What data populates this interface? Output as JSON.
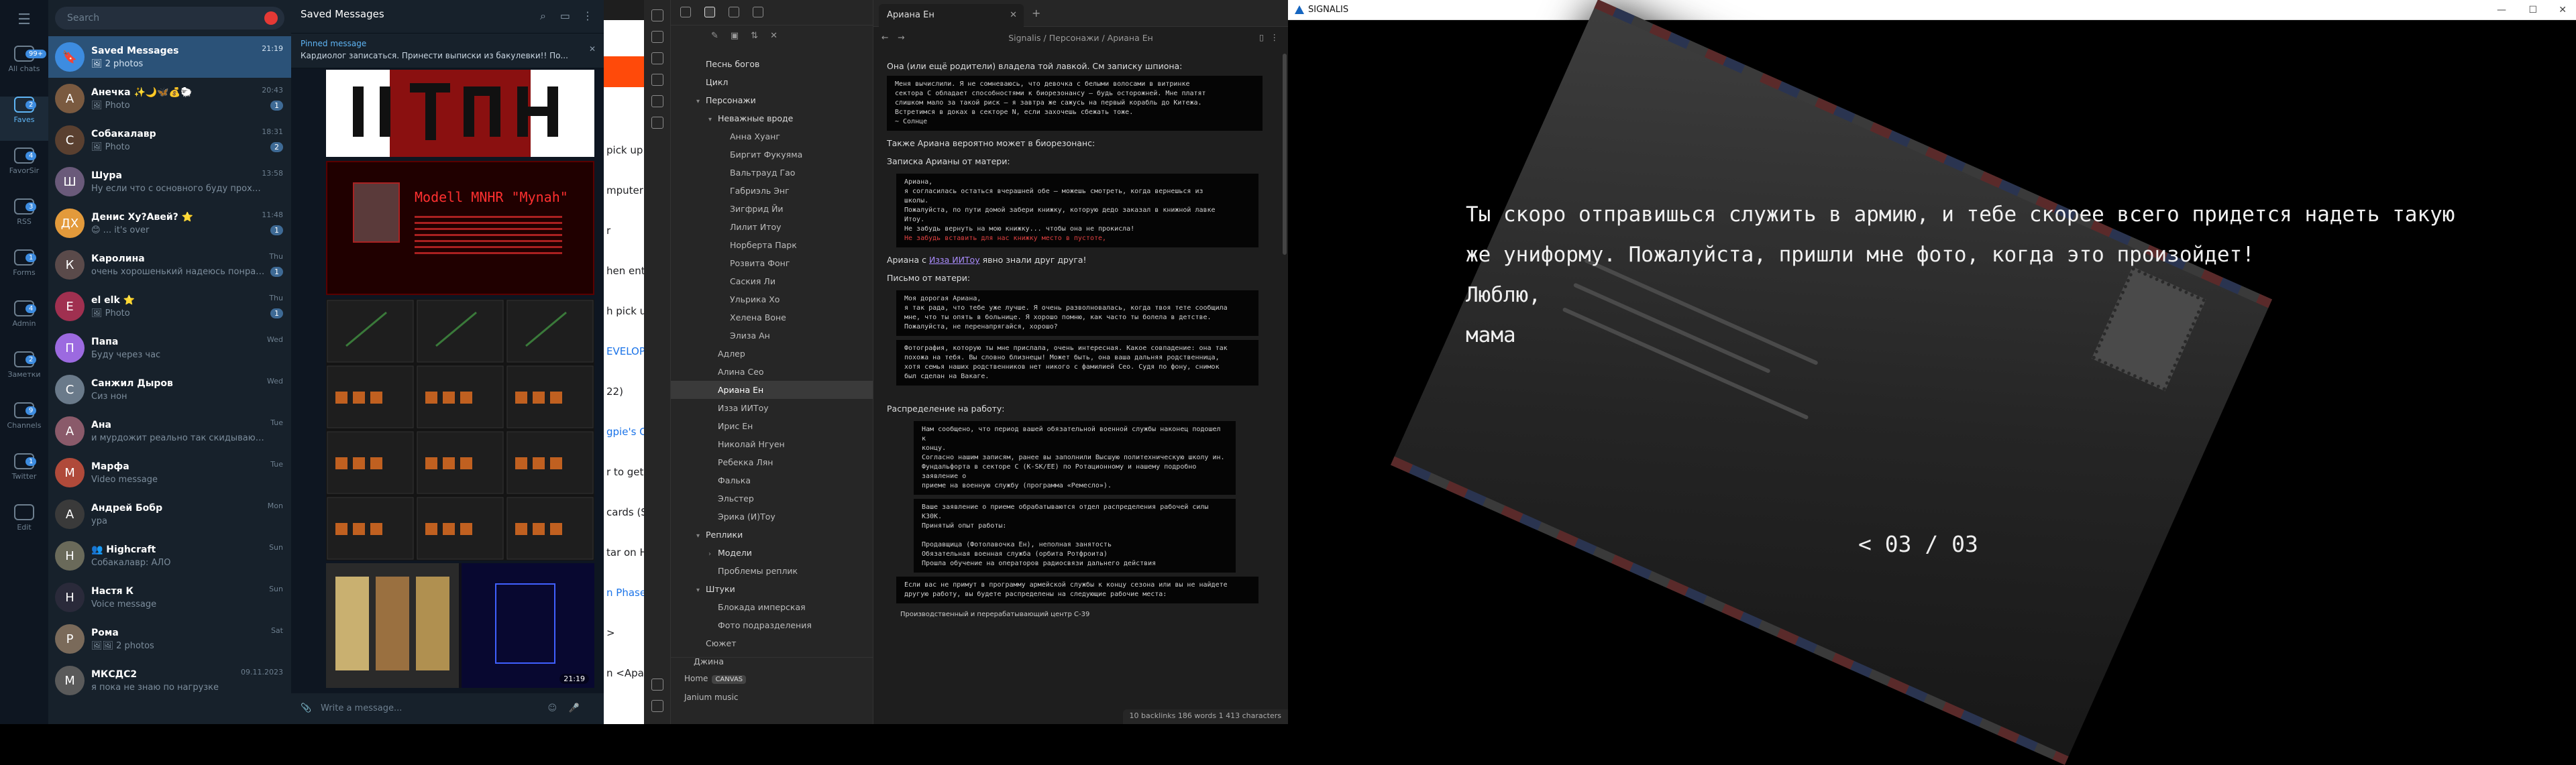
{
  "telegram": {
    "search_placeholder": "Search",
    "folders": [
      {
        "label": "All chats",
        "badge": "99+"
      },
      {
        "label": "Faves",
        "badge": "2",
        "active": true
      },
      {
        "label": "FavorSir",
        "badge": "4"
      },
      {
        "label": "RSS",
        "badge": "3"
      },
      {
        "label": "Forms",
        "badge": "1"
      },
      {
        "label": "Admin",
        "badge": "4"
      },
      {
        "label": "Заметки",
        "badge": "2"
      },
      {
        "label": "Channels",
        "badge": "9"
      },
      {
        "label": "Twitter",
        "badge": "1"
      },
      {
        "label": "Edit",
        "badge": ""
      }
    ],
    "chats": [
      {
        "name": "Saved Messages",
        "preview": "🖼 2 photos",
        "time": "21:19",
        "unread": "",
        "color": "#3d8ce0",
        "initial": "🔖"
      },
      {
        "name": "Анечка ✨🌙🦋💰🐑",
        "preview": "🖼 Photo",
        "time": "20:43",
        "unread": "1",
        "color": "#7a5a40",
        "initial": "А"
      },
      {
        "name": "Собакалавр",
        "preview": "🖼 Photo",
        "time": "18:31",
        "unread": "2",
        "color": "#5a4030",
        "initial": "С"
      },
      {
        "name": "Шура",
        "preview": "Ну если что с основного буду проходить",
        "time": "13:58",
        "unread": "",
        "color": "#6a5a7a",
        "initial": "Ш"
      },
      {
        "name": "Денис Ху?Авей? ⭐",
        "preview": "😊 ... it's over",
        "time": "11:48",
        "unread": "1",
        "color": "#e39a3b",
        "initial": "ДХ"
      },
      {
        "name": "Каролина",
        "preview": "очень хорошенький надеюсь понравить...",
        "time": "Thu",
        "unread": "1",
        "color": "#5a4a4a",
        "initial": "К"
      },
      {
        "name": "el elk ⭐",
        "preview": "🖼 Photo",
        "time": "Thu",
        "unread": "1",
        "color": "#a03050",
        "initial": "E"
      },
      {
        "name": "Папа",
        "preview": "Буду через час",
        "time": "Wed",
        "unread": "",
        "color": "#9c6ae0",
        "initial": "П"
      },
      {
        "name": "Санжил Дыров",
        "preview": "Сиз нон",
        "time": "Wed",
        "unread": "",
        "color": "#6a7a8a",
        "initial": "С"
      },
      {
        "name": "Ана",
        "preview": "и мурдожит реально так скидывают ...",
        "time": "Tue",
        "unread": "",
        "color": "#8a5a6a",
        "initial": "А"
      },
      {
        "name": "Марфа",
        "preview": "Video message",
        "time": "Tue",
        "unread": "",
        "color": "#b04a3a",
        "initial": "М"
      },
      {
        "name": "Андрей Бобр",
        "preview": "ура",
        "time": "Mon",
        "unread": "",
        "color": "#3a3a3a",
        "initial": "А"
      },
      {
        "name": "👥 Highcraft",
        "preview": "Собакалавр: АЛО",
        "time": "Sun",
        "unread": "",
        "color": "#6a6a5a",
        "initial": "H"
      },
      {
        "name": "Настя К",
        "preview": "Voice message",
        "time": "Sun",
        "unread": "",
        "color": "#2a2a3a",
        "initial": "Н"
      },
      {
        "name": "Рома",
        "preview": "🖼🖼 2 photos",
        "time": "Sat",
        "unread": "",
        "color": "#7a6a5a",
        "initial": "Р"
      },
      {
        "name": "МКСДС2",
        "preview": "я пока не знаю по нагрузке",
        "time": "09.11.2023",
        "unread": "",
        "color": "#5a5a5a",
        "initial": "М"
      }
    ],
    "conversation": {
      "title": "Saved Messages",
      "pinned_label": "Pinned message",
      "pinned_text": "Кардиолог записаться. Принести выписки из бакулевки!! По...",
      "poster_text": "Modell MNHR \"Mynah\"",
      "time": "21:19",
      "compose_placeholder": "Write a message..."
    }
  },
  "browser_sliver": {
    "lines": [
      "pick up",
      "mputer t",
      "r",
      "hen ente",
      "h pick up",
      "EVELOP",
      "22)",
      "gpie's Cl",
      "r to get",
      "cards (S",
      "tar on H",
      "n Phase",
      ">",
      "n <Apar"
    ]
  },
  "obsidian": {
    "tree": [
      {
        "label": "Песнь богов",
        "indent": 1,
        "type": "folder"
      },
      {
        "label": "Цикл",
        "indent": 1,
        "type": "folder"
      },
      {
        "label": "Персонажи",
        "indent": 1,
        "type": "folder",
        "arrow": "▾"
      },
      {
        "label": "Неважные вроде",
        "indent": 2,
        "type": "folder",
        "arrow": "▾"
      },
      {
        "label": "Анна Хуанг",
        "indent": 3
      },
      {
        "label": "Биргит Фукуяма",
        "indent": 3
      },
      {
        "label": "Вальтрауд Гао",
        "indent": 3
      },
      {
        "label": "Габриэль Энг",
        "indent": 3
      },
      {
        "label": "Зигфрид Йи",
        "indent": 3
      },
      {
        "label": "Лилит Итоу",
        "indent": 3
      },
      {
        "label": "Норберта Парк",
        "indent": 3
      },
      {
        "label": "Розвита Фонг",
        "indent": 3
      },
      {
        "label": "Саския Ли",
        "indent": 3
      },
      {
        "label": "Ульрика Хо",
        "indent": 3
      },
      {
        "label": "Хелена Воне",
        "indent": 3
      },
      {
        "label": "Элиза Ан",
        "indent": 3
      },
      {
        "label": "Адлер",
        "indent": 2
      },
      {
        "label": "Алина Сео",
        "indent": 2
      },
      {
        "label": "Ариана Ен",
        "indent": 2,
        "active": true
      },
      {
        "label": "Изза ИИТоу",
        "indent": 2
      },
      {
        "label": "Ирис Ен",
        "indent": 2
      },
      {
        "label": "Николай Нгуен",
        "indent": 2
      },
      {
        "label": "Ребекка Лян",
        "indent": 2
      },
      {
        "label": "Фалька",
        "indent": 2
      },
      {
        "label": "Эльстер",
        "indent": 2
      },
      {
        "label": "Эрика (И)Тоу",
        "indent": 2
      },
      {
        "label": "Реплики",
        "indent": 1,
        "type": "folder",
        "arrow": "▾"
      },
      {
        "label": "Модели",
        "indent": 2,
        "type": "folder",
        "arrow": "›"
      },
      {
        "label": "Проблемы реплик",
        "indent": 2
      },
      {
        "label": "Штуки",
        "indent": 1,
        "type": "folder",
        "arrow": "▾"
      },
      {
        "label": "Блокада имперская",
        "indent": 2
      },
      {
        "label": "Фото подразделения",
        "indent": 2
      },
      {
        "label": "Сюжет",
        "indent": 1
      },
      {
        "label": "Джина",
        "indent": 0
      }
    ],
    "vault_name": "Home",
    "vault_badge": "CANVAS",
    "vault_sub": "Janium music",
    "tab_title": "Ариана Ен",
    "breadcrumb": "Signalis / Персонажи / Ариана Ен",
    "content": {
      "intro": "Она (или ещё родители) владела той лавкой. См записку шпиона:",
      "spy_note": [
        "Меня вычислили. Я не сомневаюсь, что девочка с белыми волосами в витринке",
        "сектора С обладает способностями к биорезонансу — будь осторожней. Мне платят",
        "слишком мало за такой риск — я завтра же сажусь на первый корабль до Китежа.",
        "Встретимся в доках в секторе N, если захочешь сбежать тоже.",
        "~ Солнце"
      ],
      "bio": "Также Ариана вероятно может в биорезонанс:",
      "mom_title": "Записка Арианы от матери:",
      "mom_note": [
        "Ариана,",
        "я согласилась остаться вчерашней обе — можешь смотреть, когда вернешься из",
        "школы.",
        "Пожалуйста, по пути домой забери книжку, которую дедо заказал в книжной лавке",
        "Итоу.",
        "Не забудь вернуть на мою книжку... чтобы она не прокисла!"
      ],
      "mom_red": "Не забудь вставить для нас книжку место в пустоте,",
      "knew_pre": "Ариана с",
      "knew_link": "Изза ИИТоу",
      "knew_post": "явно знали друг друга!",
      "letters_title": "Письмо от матери:",
      "letter1": [
        "Моя дорогая Ариана,",
        "я так рада, что тебе уже лучше. Я очень разволновалась, когда твоя тете сообщила",
        "мне, что ты опять в больнице. Я хорошо помню, как часто ты болела в детстве.",
        "Пожалуйста, не перенапрягайся, хорошо?"
      ],
      "letter2": [
        "Фотография, которую ты мне прислала, очень интересная. Какое совпадение: она так",
        "похожа на тебя. Вы словно близнецы! Может быть, она ваша дальняя родственница,",
        "хотя семья наших родственников нет никого с фамилией Сео. Судя по фону, снимок",
        "был сделан на Вакаге."
      ],
      "assign_title": "Распределение на работу:",
      "assign1": [
        "Нам сообщено, что период вашей обязательной военной службы наконец подошел к",
        "концу.",
        "Согласно нашим записям, ранее вы заполнили Высшую политехническую школу ин.",
        "Фундальфорта в секторе С (К-SK/ЕЕ) по Ротационному и нашему подробно заявление о",
        "приеме на военную службу (программа «Ремесло»)."
      ],
      "assign2": [
        "Ваше заявление о приеме обрабатываются отдел распределения рабочей силы К30К.",
        "Принятый опыт работы:",
        "",
        "    Продавщица (Фотолавочка Ен), неполная занятость",
        "    Обязательная военная служба (орбита Ротфроита)",
        "    Прошла обучение на операторов радиосвязи дальнего действия"
      ],
      "assign3": [
        "Если вас не примут в программу армейской службы к концу сезона или вы не найдете",
        "другую работу, вы будете распределены на следующие рабочие места:"
      ],
      "assign4": "Производственный и перерабатывающий центр С-39"
    },
    "status": "10 backlinks   186 words   1 413 characters"
  },
  "signalis": {
    "window_title": "SIGNALIS",
    "lines": [
      "Ты скоро отправишься служить в армию, и тебе скорее всего придется надеть такую",
      "же униформу. Пожалуйста, пришли мне фото, когда это произойдет!",
      "Люблю,",
      "мама"
    ],
    "pager": "< 03 / 03"
  }
}
